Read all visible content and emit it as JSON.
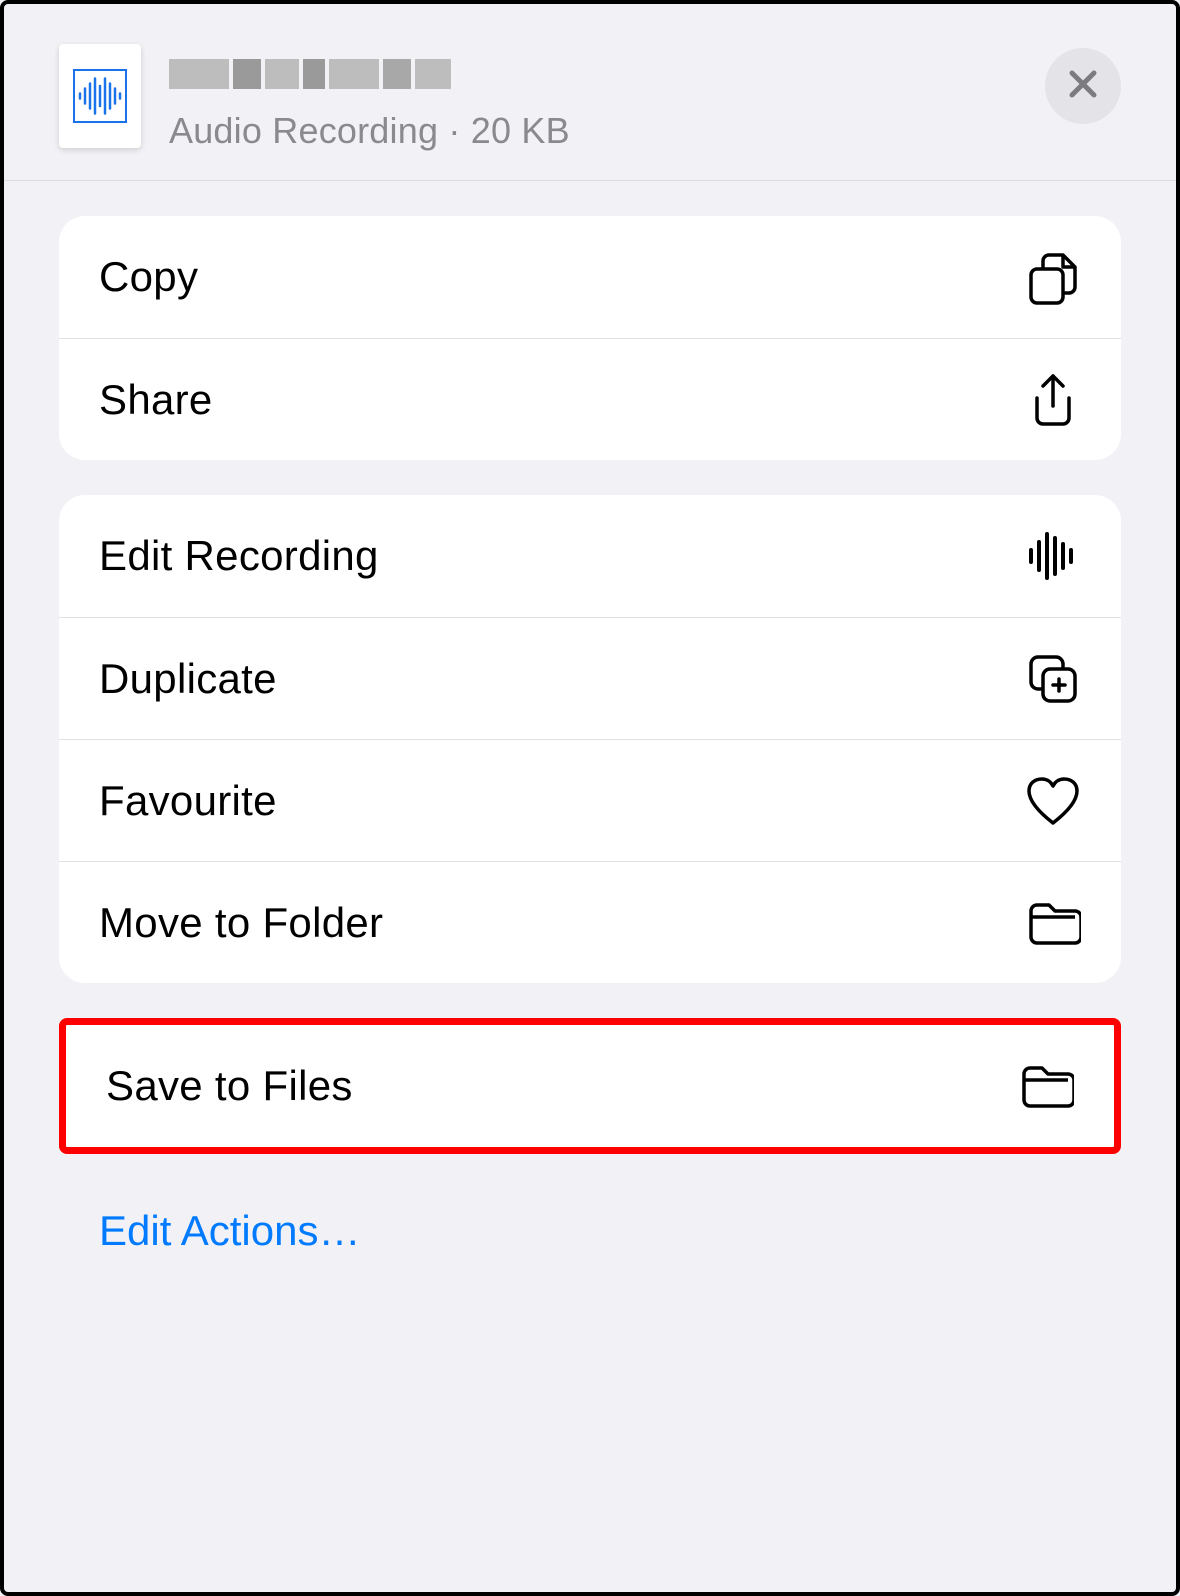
{
  "file": {
    "type": "Audio Recording",
    "size": "20 KB",
    "subtitle": "Audio Recording · 20 KB"
  },
  "actions": {
    "copy": "Copy",
    "share": "Share",
    "edit_recording": "Edit Recording",
    "duplicate": "Duplicate",
    "favourite": "Favourite",
    "move_to_folder": "Move to Folder",
    "save_to_files": "Save to Files",
    "edit_actions": "Edit Actions…"
  }
}
